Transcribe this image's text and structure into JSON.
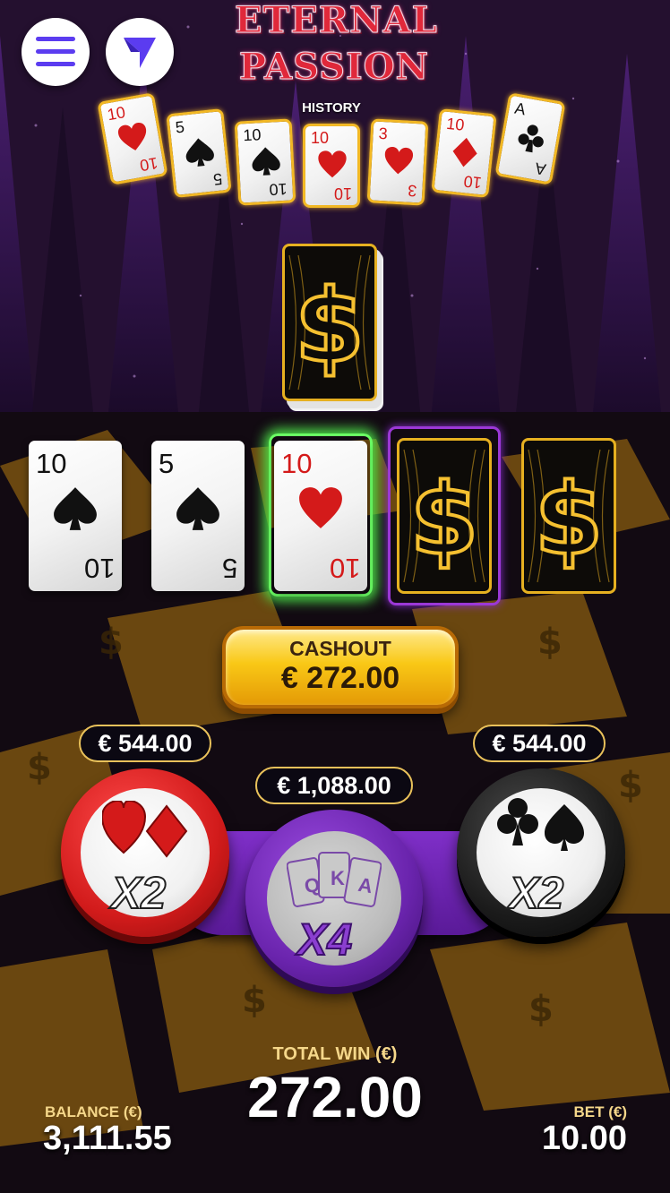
{
  "game": {
    "title_line1": "ETERNAL",
    "title_line2": "PASSION",
    "history_label": "HISTORY"
  },
  "icons": {
    "menu": "hamburger-menu-icon",
    "nav": "navigation-arrow-icon",
    "card_back": "dollar-sign-icon",
    "suits": [
      "heart-icon",
      "spade-icon",
      "diamond-icon",
      "club-icon"
    ]
  },
  "history": [
    {
      "rank": "10",
      "suit": "heart",
      "color": "#d41a1a"
    },
    {
      "rank": "5",
      "suit": "spade",
      "color": "#111111"
    },
    {
      "rank": "10",
      "suit": "spade",
      "color": "#111111"
    },
    {
      "rank": "10",
      "suit": "heart",
      "color": "#d41a1a"
    },
    {
      "rank": "3",
      "suit": "heart",
      "color": "#d41a1a"
    },
    {
      "rank": "10",
      "suit": "diamond",
      "color": "#d41a1a"
    },
    {
      "rank": "A",
      "suit": "club",
      "color": "#111111"
    }
  ],
  "row": [
    {
      "rank": "10",
      "suit": "spade",
      "state": "revealed"
    },
    {
      "rank": "5",
      "suit": "spade",
      "state": "revealed"
    },
    {
      "rank": "10",
      "suit": "heart",
      "state": "current"
    },
    {
      "state": "next-face-down"
    },
    {
      "state": "face-down"
    }
  ],
  "cashout": {
    "label": "CASHOUT",
    "value": "€ 272.00"
  },
  "bets": {
    "red": {
      "payout": "€ 544.00",
      "multiplier": "X2",
      "color": "#d21b1b"
    },
    "face": {
      "payout": "€ 1,088.00",
      "multiplier": "X4",
      "letters": [
        "Q",
        "K",
        "A"
      ],
      "color": "#6a24ad"
    },
    "black": {
      "payout": "€ 544.00",
      "multiplier": "X2",
      "color": "#1b1b1b"
    }
  },
  "hud": {
    "total_win_label": "TOTAL WIN (€)",
    "total_win_value": "272.00",
    "balance_label": "BALANCE (€)",
    "balance_value": "3,111.55",
    "bet_label": "BET (€)",
    "bet_value": "10.00"
  },
  "colors": {
    "gold": "#e6b020",
    "accent_purple": "#5b3cf0",
    "selected_glow": "#4ee44a"
  }
}
